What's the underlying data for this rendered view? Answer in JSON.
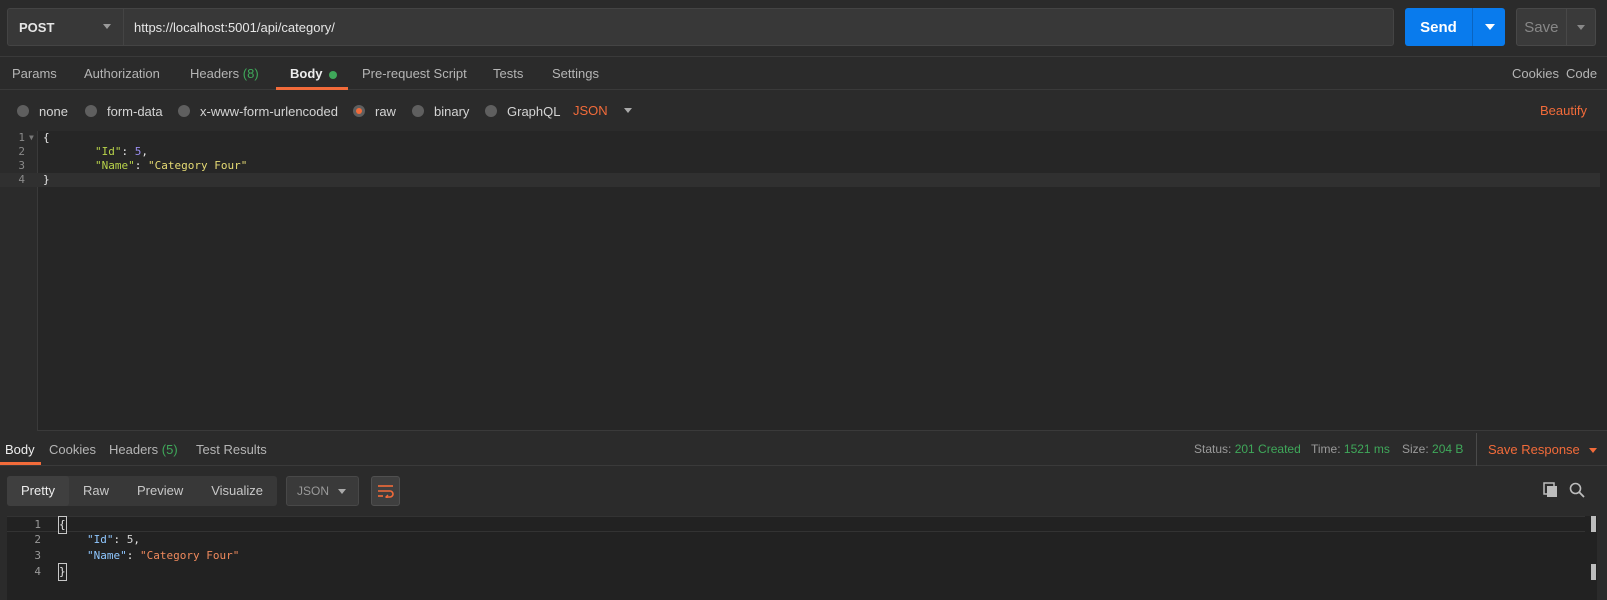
{
  "request": {
    "method": "POST",
    "url": "https://localhost:5001/api/category/",
    "send_label": "Send",
    "save_label": "Save"
  },
  "request_tabs": {
    "params": "Params",
    "authorization": "Authorization",
    "headers": "Headers",
    "headers_count": "(8)",
    "body": "Body",
    "pre_request": "Pre-request Script",
    "tests": "Tests",
    "settings": "Settings",
    "cookies": "Cookies",
    "code": "Code"
  },
  "body_types": {
    "none": "none",
    "form_data": "form-data",
    "urlencoded": "x-www-form-urlencoded",
    "raw": "raw",
    "binary": "binary",
    "graphql": "GraphQL",
    "selected": "raw",
    "format": "JSON",
    "beautify": "Beautify"
  },
  "request_body": {
    "lines": [
      {
        "n": "1",
        "open": "{"
      },
      {
        "n": "2",
        "key": "\"Id\"",
        "value": "5",
        "trail": ","
      },
      {
        "n": "3",
        "key": "\"Name\"",
        "value": "\"Category Four\"",
        "trail": ""
      },
      {
        "n": "4",
        "close": "}"
      }
    ]
  },
  "response_tabs": {
    "body": "Body",
    "cookies": "Cookies",
    "headers": "Headers",
    "headers_count": "(5)",
    "test_results": "Test Results"
  },
  "response_meta": {
    "status_label": "Status:",
    "status_value": "201 Created",
    "time_label": "Time:",
    "time_value": "1521 ms",
    "size_label": "Size:",
    "size_value": "204 B",
    "save_response": "Save Response"
  },
  "response_view": {
    "options": [
      "Pretty",
      "Raw",
      "Preview",
      "Visualize"
    ],
    "selected": "Pretty",
    "format": "JSON"
  },
  "response_body": {
    "lines": [
      {
        "n": "1",
        "open": "{"
      },
      {
        "n": "2",
        "key": "\"Id\"",
        "value": "5",
        "trail": ","
      },
      {
        "n": "3",
        "key": "\"Name\"",
        "value": "\"Category Four\"",
        "trail": ""
      },
      {
        "n": "4",
        "close": "}"
      }
    ]
  },
  "colors": {
    "accent": "#f26b3a",
    "send_blue": "#097bed",
    "success_green": "#3fa85a"
  },
  "icons": [
    "chevron-down-icon",
    "word-wrap-icon",
    "copy-icon",
    "search-icon"
  ]
}
